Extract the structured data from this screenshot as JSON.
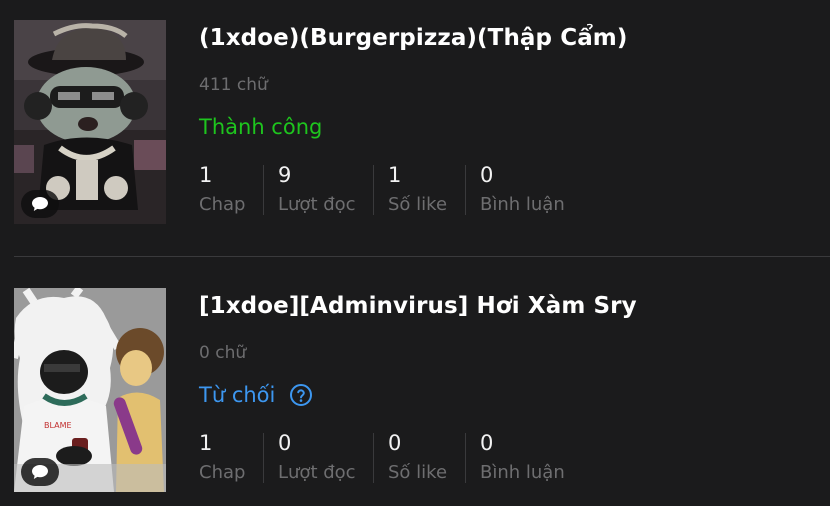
{
  "stories": [
    {
      "title": "(1xdoe)(Burgerpizza)(Thập Cẩm)",
      "word_count": "411 chữ",
      "status": "Thành công",
      "status_color": "#1ec51e",
      "stats": {
        "chap": {
          "value": "1",
          "label": "Chap"
        },
        "views": {
          "value": "9",
          "label": "Lượt đọc"
        },
        "likes": {
          "value": "1",
          "label": "Số like"
        },
        "comments": {
          "value": "0",
          "label": "Bình luận"
        }
      },
      "cover_icon": "comment-bubble-icon"
    },
    {
      "title": "[1xdoe][Adminvirus] Hơi Xàm Sry",
      "word_count": "0 chữ",
      "status": "Từ chối",
      "status_color": "#3d97f0",
      "status_help_icon": "question-circle-icon",
      "stats": {
        "chap": {
          "value": "1",
          "label": "Chap"
        },
        "views": {
          "value": "0",
          "label": "Lượt đọc"
        },
        "likes": {
          "value": "0",
          "label": "Số like"
        },
        "comments": {
          "value": "0",
          "label": "Bình luận"
        }
      },
      "cover_icon": "comment-bubble-icon"
    }
  ]
}
